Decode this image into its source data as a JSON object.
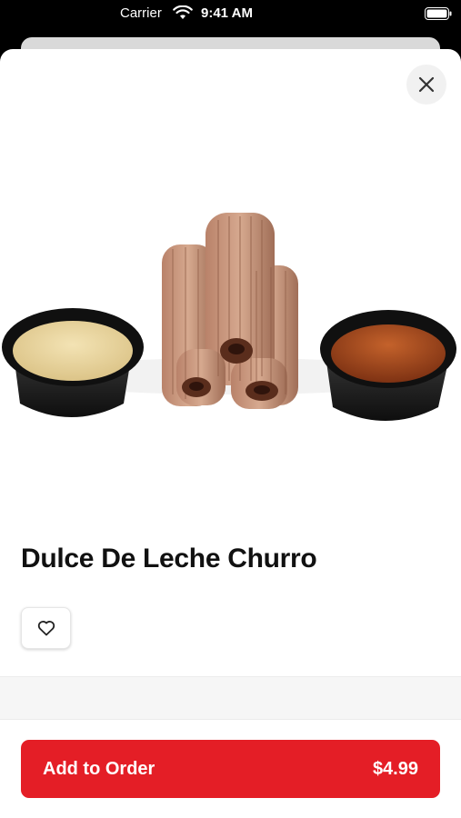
{
  "status_bar": {
    "carrier": "Carrier",
    "time": "9:41 AM"
  },
  "product": {
    "name": "Dulce De Leche Churro"
  },
  "order_button": {
    "label": "Add to Order",
    "price": "$4.99"
  },
  "icons": {
    "close": "close-icon",
    "favorite": "heart-icon",
    "wifi": "wifi-icon",
    "battery": "battery-icon"
  },
  "colors": {
    "accent": "#e41e26",
    "background": "#ffffff"
  }
}
